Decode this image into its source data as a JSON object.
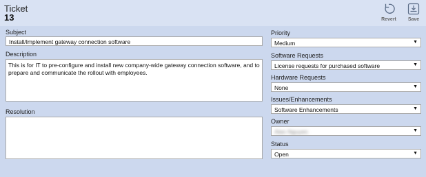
{
  "header": {
    "title": "Ticket",
    "number": "13",
    "revert_label": "Revert",
    "save_label": "Save"
  },
  "form": {
    "subject_label": "Subject",
    "subject_value": "Install/Implement gateway connection software",
    "description_label": "Description",
    "description_value": "This is for IT to pre-configure and install new company-wide gateway connection software, and to prepare and communicate the rollout with employees.",
    "resolution_label": "Resolution",
    "resolution_value": ""
  },
  "side": {
    "priority_label": "Priority",
    "priority_value": "Medium",
    "software_label": "Software Requests",
    "software_value": "License requests for purchased software",
    "hardware_label": "Hardware Requests",
    "hardware_value": "None",
    "issues_label": "Issues/Enhancements",
    "issues_value": "Software Enhancements",
    "owner_label": "Owner",
    "owner_value": "Alan Nguyen",
    "status_label": "Status",
    "status_value": "Open"
  },
  "icons": {
    "revert": "revert-icon",
    "save": "save-icon",
    "dropdown": "dropdown-arrow-icon"
  }
}
